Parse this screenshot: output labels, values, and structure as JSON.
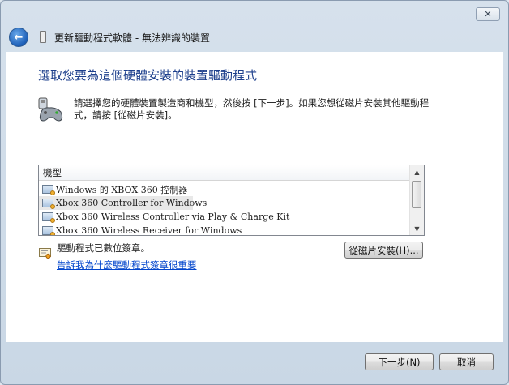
{
  "window": {
    "title": "更新驅動程式軟體 - 無法辨識的裝置",
    "close_label": "✕"
  },
  "page": {
    "heading": "選取您要為這個硬體安裝的裝置驅動程式",
    "instruction": "請選擇您的硬體裝置製造商和機型，然後按 [下一步]。如果您想從磁片安裝其他驅動程式，請按 [從磁片安裝]。"
  },
  "model_list": {
    "header": "機型",
    "items": [
      {
        "label": "Windows 的 XBOX 360 控制器",
        "selected": false
      },
      {
        "label": "Xbox 360 Controller for Windows",
        "selected": true
      },
      {
        "label": "Xbox 360 Wireless Controller via Play & Charge Kit",
        "selected": false
      },
      {
        "label": "Xbox 360 Wireless Receiver for Windows",
        "selected": false
      }
    ]
  },
  "signature": {
    "status": "驅動程式已數位簽章。",
    "link": "告訴我為什麼驅動程式簽章很重要"
  },
  "buttons": {
    "have_disk": "從磁片安裝(H)...",
    "next": "下一步(N)",
    "cancel": "取消"
  },
  "icons": {
    "back": "back-arrow-icon",
    "title": "device-icon",
    "hardware": "game-controller-icon",
    "signature": "signed-certificate-icon"
  },
  "colors": {
    "heading": "#1d3f8c",
    "link": "#0044cc",
    "back_button": "#1d5fb8"
  }
}
